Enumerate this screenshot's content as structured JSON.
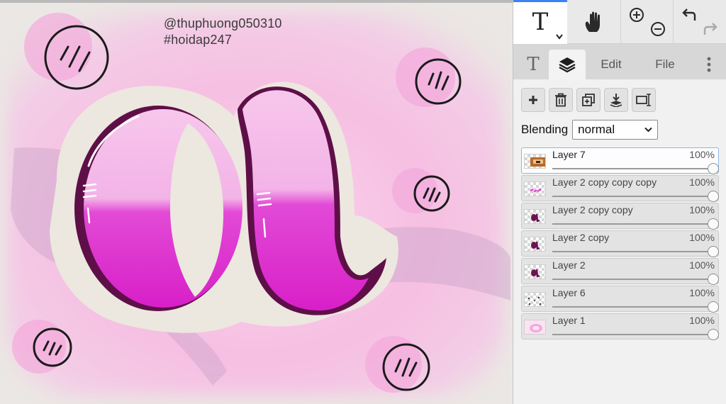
{
  "canvas": {
    "watermark_line1": "@thuphuong050310",
    "watermark_line2": "#hoidap247"
  },
  "toolbar": {
    "text_tool_glyph": "T",
    "tools": [
      "text-tool",
      "hand-tool",
      "zoom-in",
      "zoom-out",
      "undo",
      "redo"
    ]
  },
  "tabs": {
    "text_tab_glyph": "T",
    "edit": "Edit",
    "file": "File",
    "active": "layers"
  },
  "layers_panel": {
    "actions": [
      "add-layer",
      "delete-layer",
      "duplicate-layer",
      "merge-down",
      "resize-layer"
    ],
    "blending_label": "Blending",
    "blending_value": "normal",
    "layers": [
      {
        "name": "Layer 7",
        "opacity_label": "100%",
        "opacity": 1.0,
        "active": true,
        "thumb": "photo"
      },
      {
        "name": "Layer 2 copy copy copy",
        "opacity_label": "100%",
        "opacity": 1.0,
        "active": false,
        "thumb": "pink-dots"
      },
      {
        "name": "Layer 2 copy copy",
        "opacity_label": "100%",
        "opacity": 1.0,
        "active": false,
        "thumb": "letter-a"
      },
      {
        "name": "Layer 2 copy",
        "opacity_label": "100%",
        "opacity": 1.0,
        "active": false,
        "thumb": "letter-a"
      },
      {
        "name": "Layer 2",
        "opacity_label": "100%",
        "opacity": 1.0,
        "active": false,
        "thumb": "letter-a"
      },
      {
        "name": "Layer 6",
        "opacity_label": "100%",
        "opacity": 1.0,
        "active": false,
        "thumb": "dots"
      },
      {
        "name": "Layer 1",
        "opacity_label": "100%",
        "opacity": 1.0,
        "active": false,
        "thumb": "pink-fill"
      }
    ]
  },
  "colors": {
    "accent": "#3b82f6",
    "magenta": "#e24ad6",
    "dark_magenta": "#6b1352",
    "pink_bg": "#f7c4e4"
  }
}
